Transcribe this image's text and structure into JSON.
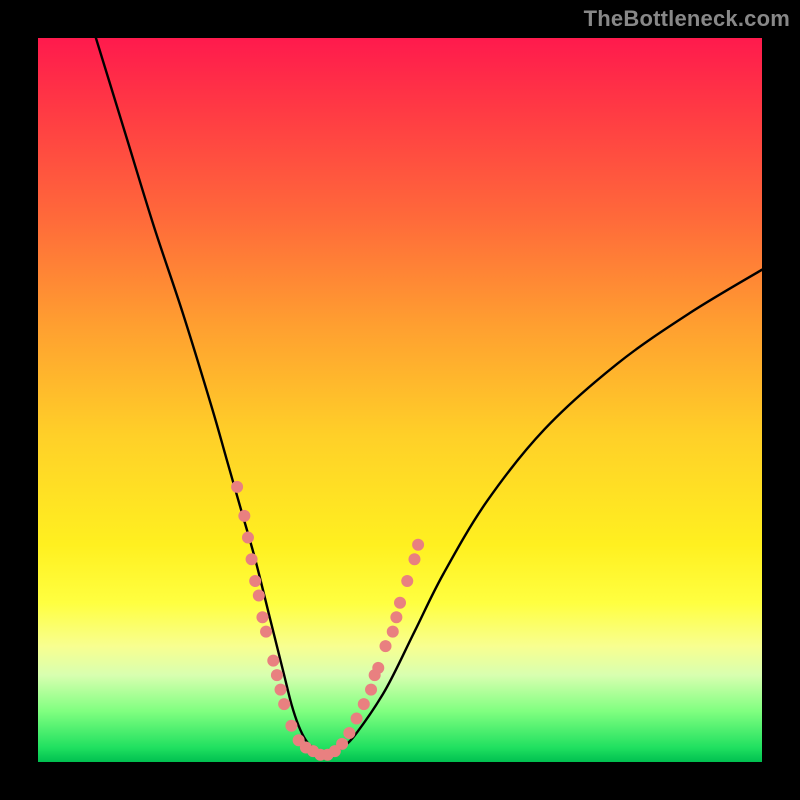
{
  "watermark": "TheBottleneck.com",
  "chart_data": {
    "type": "line",
    "title": "",
    "xlabel": "",
    "ylabel": "",
    "xlim": [
      0,
      100
    ],
    "ylim": [
      0,
      100
    ],
    "background_gradient": {
      "direction": "vertical",
      "stops": [
        {
          "pos": 0,
          "color": "#ff1a4d"
        },
        {
          "pos": 25,
          "color": "#ff6a3a"
        },
        {
          "pos": 55,
          "color": "#ffd028"
        },
        {
          "pos": 78,
          "color": "#ffff40"
        },
        {
          "pos": 93,
          "color": "#80ff80"
        },
        {
          "pos": 100,
          "color": "#00c050"
        }
      ]
    },
    "series": [
      {
        "name": "bottleneck-curve",
        "color": "#000000",
        "x": [
          8,
          12,
          16,
          20,
          24,
          26,
          28,
          30,
          32,
          33,
          34,
          35,
          36,
          37,
          38,
          40,
          42,
          44,
          48,
          52,
          56,
          62,
          70,
          80,
          90,
          100
        ],
        "values": [
          100,
          87,
          74,
          62,
          49,
          42,
          35,
          28,
          20,
          16,
          12,
          8,
          5,
          3,
          2,
          1,
          2,
          4,
          10,
          18,
          26,
          36,
          46,
          55,
          62,
          68
        ]
      }
    ],
    "markers": {
      "name": "highlight-dots",
      "color": "#e98080",
      "radius": 6,
      "points": [
        {
          "x": 27.5,
          "y": 38
        },
        {
          "x": 28.5,
          "y": 34
        },
        {
          "x": 29.0,
          "y": 31
        },
        {
          "x": 29.5,
          "y": 28
        },
        {
          "x": 30.0,
          "y": 25
        },
        {
          "x": 30.5,
          "y": 23
        },
        {
          "x": 31.0,
          "y": 20
        },
        {
          "x": 31.5,
          "y": 18
        },
        {
          "x": 32.5,
          "y": 14
        },
        {
          "x": 33.0,
          "y": 12
        },
        {
          "x": 33.5,
          "y": 10
        },
        {
          "x": 34.0,
          "y": 8
        },
        {
          "x": 35.0,
          "y": 5
        },
        {
          "x": 36.0,
          "y": 3
        },
        {
          "x": 37.0,
          "y": 2
        },
        {
          "x": 38.0,
          "y": 1.5
        },
        {
          "x": 39.0,
          "y": 1
        },
        {
          "x": 40.0,
          "y": 1
        },
        {
          "x": 41.0,
          "y": 1.5
        },
        {
          "x": 42.0,
          "y": 2.5
        },
        {
          "x": 43.0,
          "y": 4
        },
        {
          "x": 44.0,
          "y": 6
        },
        {
          "x": 45.0,
          "y": 8
        },
        {
          "x": 46.0,
          "y": 10
        },
        {
          "x": 46.5,
          "y": 12
        },
        {
          "x": 47.0,
          "y": 13
        },
        {
          "x": 48.0,
          "y": 16
        },
        {
          "x": 49.0,
          "y": 18
        },
        {
          "x": 49.5,
          "y": 20
        },
        {
          "x": 50.0,
          "y": 22
        },
        {
          "x": 51.0,
          "y": 25
        },
        {
          "x": 52.0,
          "y": 28
        },
        {
          "x": 52.5,
          "y": 30
        }
      ]
    }
  }
}
